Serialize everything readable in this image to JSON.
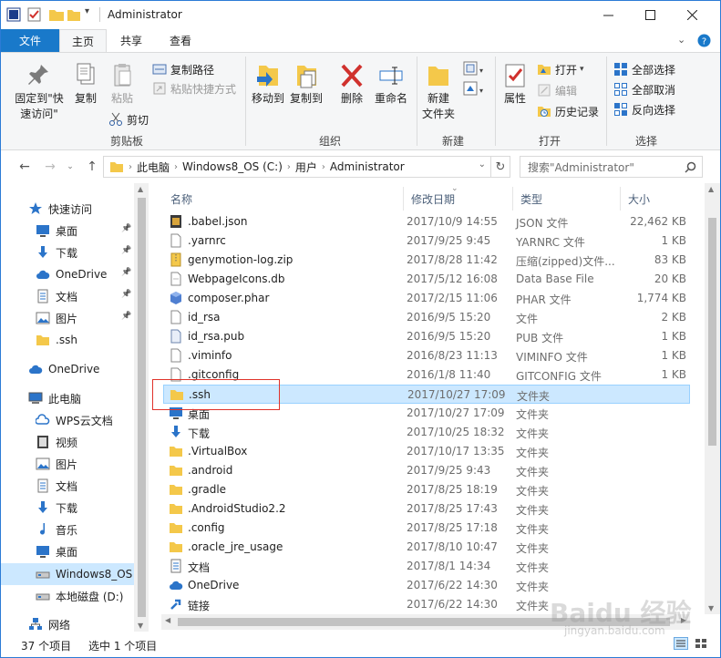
{
  "window": {
    "title": "Administrator"
  },
  "ribbon_tabs": {
    "file": "文件",
    "home": "主页",
    "share": "共享",
    "view": "查看"
  },
  "ribbon": {
    "clipboard": {
      "pin_quick": "固定到\"快速访问\"",
      "copy": "复制",
      "paste": "粘贴",
      "copy_path": "复制路径",
      "paste_shortcut": "粘贴快捷方式",
      "cut": "剪切",
      "label": "剪贴板"
    },
    "organize": {
      "move_to": "移动到",
      "copy_to": "复制到",
      "delete": "删除",
      "rename": "重命名",
      "label": "组织"
    },
    "new": {
      "new_folder": "新建\n文件夹",
      "label": "新建"
    },
    "open": {
      "properties": "属性",
      "open": "打开",
      "edit": "编辑",
      "history": "历史记录",
      "label": "打开"
    },
    "select": {
      "select_all": "全部选择",
      "select_none": "全部取消",
      "invert": "反向选择",
      "label": "选择"
    }
  },
  "address": {
    "crumbs": [
      "此电脑",
      "Windows8_OS (C:)",
      "用户",
      "Administrator"
    ]
  },
  "search": {
    "placeholder": "搜索\"Administrator\""
  },
  "nav": {
    "items": [
      {
        "label": "快速访问",
        "icon": "star-icon"
      },
      {
        "label": "桌面",
        "icon": "desktop-icon"
      },
      {
        "label": "下载",
        "icon": "download-icon"
      },
      {
        "label": "OneDrive",
        "icon": "cloud-icon"
      },
      {
        "label": "文档",
        "icon": "document-icon"
      },
      {
        "label": "图片",
        "icon": "picture-icon"
      },
      {
        "label": ".ssh",
        "icon": "folder-icon"
      },
      {
        "label": "OneDrive",
        "icon": "cloud-icon"
      },
      {
        "label": "此电脑",
        "icon": "computer-icon"
      },
      {
        "label": "WPS云文档",
        "icon": "wps-cloud-icon"
      },
      {
        "label": "视频",
        "icon": "video-icon"
      },
      {
        "label": "图片",
        "icon": "picture-icon"
      },
      {
        "label": "文档",
        "icon": "document-icon"
      },
      {
        "label": "下载",
        "icon": "download-icon"
      },
      {
        "label": "音乐",
        "icon": "music-icon"
      },
      {
        "label": "桌面",
        "icon": "desktop-icon"
      },
      {
        "label": "Windows8_OS",
        "icon": "drive-icon"
      },
      {
        "label": "本地磁盘 (D:)",
        "icon": "drive-icon"
      },
      {
        "label": "网络",
        "icon": "network-icon"
      }
    ]
  },
  "columns": {
    "name": "名称",
    "date": "修改日期",
    "type": "类型",
    "size": "大小"
  },
  "files": [
    {
      "name": ".babel.json",
      "date": "2017/10/9 14:55",
      "type": "JSON 文件",
      "size": "22,462 KB",
      "icon": "json-file-icon"
    },
    {
      "name": ".yarnrc",
      "date": "2017/9/25 9:45",
      "type": "YARNRC 文件",
      "size": "1 KB",
      "icon": "file-icon"
    },
    {
      "name": "genymotion-log.zip",
      "date": "2017/8/28 11:42",
      "type": "压缩(zipped)文件...",
      "size": "83 KB",
      "icon": "zip-icon"
    },
    {
      "name": "WebpageIcons.db",
      "date": "2017/5/12 16:08",
      "type": "Data Base File",
      "size": "20 KB",
      "icon": "db-file-icon"
    },
    {
      "name": "composer.phar",
      "date": "2017/2/15 11:06",
      "type": "PHAR 文件",
      "size": "1,774 KB",
      "icon": "phar-icon"
    },
    {
      "name": "id_rsa",
      "date": "2016/9/5 15:20",
      "type": "文件",
      "size": "2 KB",
      "icon": "file-icon"
    },
    {
      "name": "id_rsa.pub",
      "date": "2016/9/5 15:20",
      "type": "PUB 文件",
      "size": "1 KB",
      "icon": "pub-file-icon"
    },
    {
      "name": ".viminfo",
      "date": "2016/8/23 11:13",
      "type": "VIMINFO 文件",
      "size": "1 KB",
      "icon": "file-icon"
    },
    {
      "name": ".gitconfig",
      "date": "2016/1/8 11:40",
      "type": "GITCONFIG 文件",
      "size": "1 KB",
      "icon": "file-icon"
    },
    {
      "name": ".ssh",
      "date": "2017/10/27 17:09",
      "type": "文件夹",
      "size": "",
      "icon": "folder-icon"
    },
    {
      "name": "桌面",
      "date": "2017/10/27 17:09",
      "type": "文件夹",
      "size": "",
      "icon": "desktop-icon"
    },
    {
      "name": "下载",
      "date": "2017/10/25 18:32",
      "type": "文件夹",
      "size": "",
      "icon": "download-icon"
    },
    {
      "name": ".VirtualBox",
      "date": "2017/10/17 13:35",
      "type": "文件夹",
      "size": "",
      "icon": "folder-icon"
    },
    {
      "name": ".android",
      "date": "2017/9/25 9:43",
      "type": "文件夹",
      "size": "",
      "icon": "folder-icon"
    },
    {
      "name": ".gradle",
      "date": "2017/8/25 18:19",
      "type": "文件夹",
      "size": "",
      "icon": "folder-icon"
    },
    {
      "name": ".AndroidStudio2.2",
      "date": "2017/8/25 17:43",
      "type": "文件夹",
      "size": "",
      "icon": "folder-icon"
    },
    {
      "name": ".config",
      "date": "2017/8/25 17:18",
      "type": "文件夹",
      "size": "",
      "icon": "folder-icon"
    },
    {
      "name": ".oracle_jre_usage",
      "date": "2017/8/10 10:47",
      "type": "文件夹",
      "size": "",
      "icon": "folder-icon"
    },
    {
      "name": "文档",
      "date": "2017/8/1 14:34",
      "type": "文件夹",
      "size": "",
      "icon": "document-icon"
    },
    {
      "name": "OneDrive",
      "date": "2017/6/22 14:30",
      "type": "文件夹",
      "size": "",
      "icon": "cloud-icon"
    },
    {
      "name": "链接",
      "date": "2017/6/22 14:30",
      "type": "文件夹",
      "size": "",
      "icon": "link-icon"
    }
  ],
  "status": {
    "count": "37 个项目",
    "selected": "选中 1 个项目"
  },
  "watermark": {
    "text": "Baidu 经验",
    "sub": "jingyan.baidu.com"
  },
  "colors": {
    "accent": "#1979ca",
    "selection": "#cce8ff",
    "highlight_box": "#e0322a",
    "folder": "#f4c84a"
  }
}
